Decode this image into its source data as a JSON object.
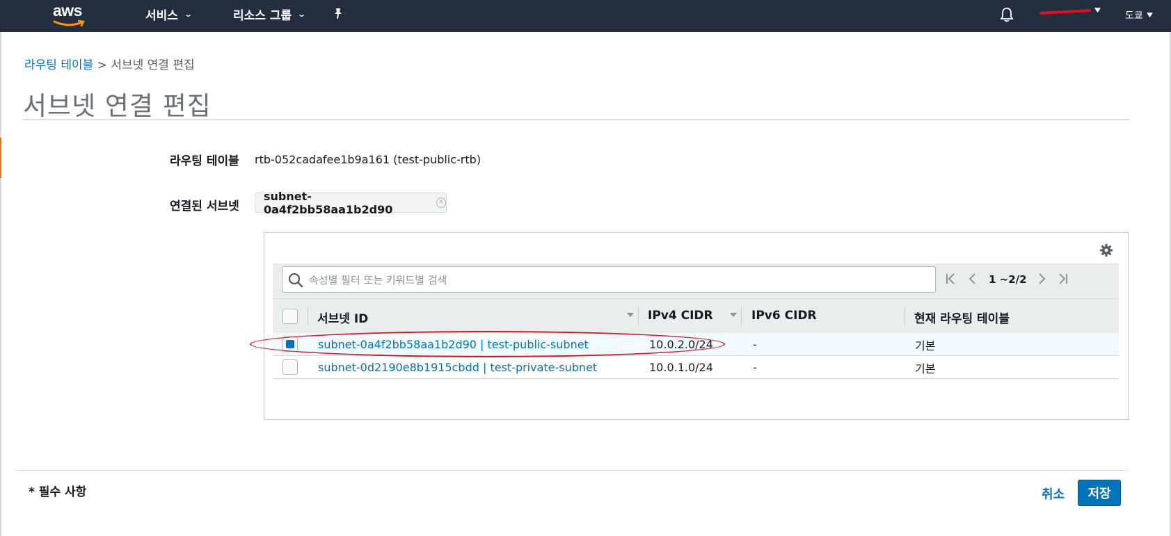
{
  "nav": {
    "logo_text": "aws",
    "services_label": "서비스",
    "resource_groups_label": "리소스 그룹",
    "region_label": "도쿄"
  },
  "breadcrumb": {
    "parent": "라우팅 테이블",
    "separator": ">",
    "current": "서브넷 연결 편집"
  },
  "page_title": "서브넷 연결 편집",
  "form": {
    "route_table_label": "라우팅 테이블",
    "route_table_value": "rtb-052cadafee1b9a161 (test-public-rtb)",
    "associated_subnets_label": "연결된 서브넷",
    "associated_subnet_chip": "subnet-0a4f2bb58aa1b2d90"
  },
  "table": {
    "search_placeholder": "속성별 필터 또는 키워드별 검색",
    "pagination": "1 ~2/2",
    "columns": [
      "서브넷 ID",
      "IPv4 CIDR",
      "IPv6 CIDR",
      "현재 라우팅 테이블"
    ],
    "rows": [
      {
        "subnet": "subnet-0a4f2bb58aa1b2d90 | test-public-subnet",
        "ipv4": "10.0.2.0/24",
        "ipv6": "-",
        "route_table": "기본",
        "selected": true
      },
      {
        "subnet": "subnet-0d2190e8b1915cbdd | test-private-subnet",
        "ipv4": "10.0.1.0/24",
        "ipv6": "-",
        "route_table": "기본",
        "selected": false
      }
    ]
  },
  "footer": {
    "required_note": "* 필수 사항",
    "cancel_label": "취소",
    "save_label": "저장"
  },
  "colors": {
    "nav_bg": "#232f3e",
    "link": "#0073bb",
    "primary_button": "#0073bb",
    "annotation": "#e0101c"
  }
}
